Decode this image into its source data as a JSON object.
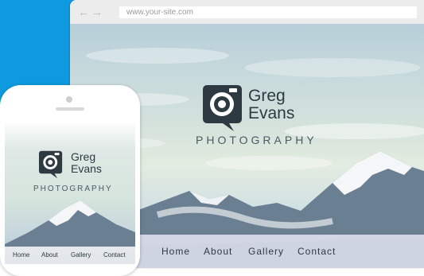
{
  "browser": {
    "url": "www.your-site.com",
    "back_icon": "arrow-left-icon",
    "forward_icon": "arrow-right-icon"
  },
  "site": {
    "name_line1": "Greg",
    "name_line2": "Evans",
    "tagline": "PHOTOGRAPHY",
    "logo_icon": "camera-speech-bubble-icon",
    "nav": [
      "Home",
      "About",
      "Gallery",
      "Contact"
    ]
  },
  "colors": {
    "accent_blue": "#0f99de",
    "logo_dark": "#2d3a42"
  }
}
